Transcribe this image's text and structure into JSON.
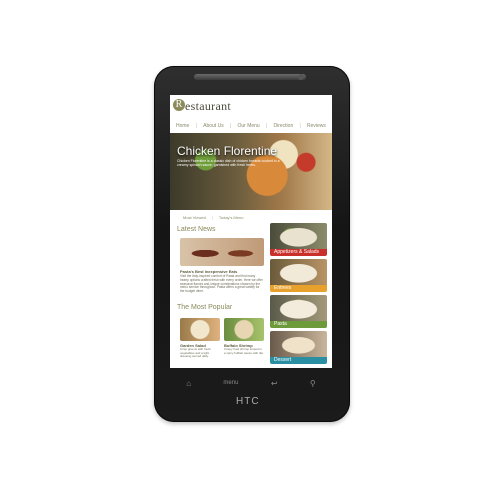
{
  "brand": "HTC",
  "site": {
    "logo_letter": "R",
    "logo_rest": "estaurant",
    "nav": [
      "Home",
      "About Us",
      "Our Menu",
      "Direction",
      "Reviews"
    ]
  },
  "hero": {
    "title": "Chicken Florentine",
    "description": "Chicken Florentine is a classic dish of chicken breasts cooked in a creamy spinach sauce, garnished with fresh herbs."
  },
  "tabs": [
    "Most Viewed",
    "Today's Menu"
  ],
  "latest_news": {
    "heading": "Latest News",
    "title": "Pasta's Best Inexpensive Eats",
    "body": "Visit the Italy-inspired comfort of Pasta and find many hearty options crafted fresh with every order. Here we offer seasonal flavors and unique combinations chosen by the menu service throughout. Pasta offers a great variety for the budget diner."
  },
  "most_popular": {
    "heading": "The Most Popular",
    "items": [
      {
        "label": "Garden Salad",
        "text": "Crisp greens with fresh vegetables and a light dressing served daily."
      },
      {
        "label": "Buffalo Shrimp",
        "text": "Crispy fried shrimp tossed in a spicy buffalo sauce with dip."
      }
    ]
  },
  "categories": [
    {
      "label": "Appetizers & Salads",
      "color": "#c9302c"
    },
    {
      "label": "Entrees",
      "color": "#e8a12a"
    },
    {
      "label": "Pasta",
      "color": "#6d9a3a"
    },
    {
      "label": "Dessert",
      "color": "#2a8fa3"
    }
  ],
  "touch_keys": {
    "home": "home-icon",
    "menu": "menu",
    "back": "back-icon",
    "search": "search-icon"
  }
}
